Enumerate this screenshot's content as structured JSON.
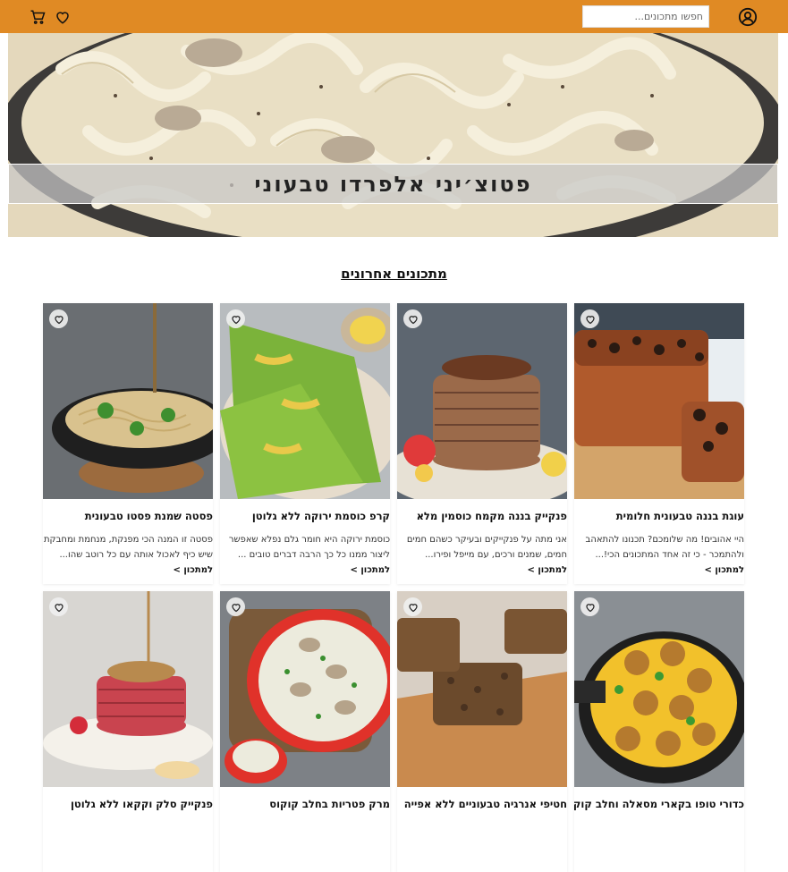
{
  "header": {
    "search_placeholder": "חפשו מתכונים...",
    "icons": [
      "cart-icon",
      "heart-icon",
      "user-icon"
    ],
    "background": "#e08a24"
  },
  "hero": {
    "title": "פטוצ׳יני אלפרדו טבעוני"
  },
  "latest": {
    "title": "מתכונים אחרונים",
    "more_label": "למתכון >",
    "cards": [
      {
        "title": "עוגת בננה טבעונית חלומית",
        "desc": "היי אהובים! מה שלומכם? תכנונו להתאהב ולהתמכר - כי זה אחד המתכונים הכי!...",
        "image": "banana-cake"
      },
      {
        "title": "פנקייק בננה מקמח כוסמין מלא",
        "desc": "אני מתה על פנקייקים ובעיקר כשהם חמים חמים, שמנים ורכים, עם מייפל ופירו...",
        "image": "pancakes"
      },
      {
        "title": "קרפ כוסמת ירוקה ללא גלוטן",
        "desc": "כוסמת ירוקה היא חומר גלם נפלא שאפשר ליצור ממנו כל כך הרבה דברים טובים ...",
        "image": "green-crepe"
      },
      {
        "title": "פסטה שמנת פסטו טבעונית",
        "desc": "פסטה זו המנה הכי מפנקת, מנחמת ומחבקת שיש כיף לאכול אותה עם כל רוטב שהו...",
        "image": "pesto-pasta"
      },
      {
        "title": "כדורי טופו בקארי מסאלה וחלב קוקוס",
        "desc": "",
        "image": "tofu-balls"
      },
      {
        "title": "חטיפי אנרגיה טבעוניים ללא אפייה",
        "desc": "",
        "image": "energy-bars"
      },
      {
        "title": "מרק פטריות בחלב קוקוס",
        "desc": "",
        "image": "mushroom-soup"
      },
      {
        "title": "פנקייק סלק וקקאו ללא גלוטן",
        "desc": "",
        "image": "beet-pancakes"
      }
    ]
  }
}
